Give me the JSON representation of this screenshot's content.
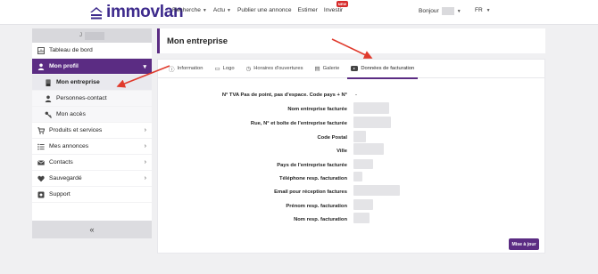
{
  "header": {
    "logo_text": "immovlan",
    "nav": [
      {
        "label": "Recherche",
        "caret": true
      },
      {
        "label": "Actu",
        "caret": true
      },
      {
        "label": "Publier une annonce",
        "caret": false
      },
      {
        "label": "Estimer",
        "caret": false
      },
      {
        "label": "Investir",
        "caret": false,
        "badge": "NEW"
      }
    ],
    "greeting": "Bonjour",
    "language": "FR"
  },
  "sidebar": {
    "user_initial": "J",
    "items": [
      {
        "label": "Tableau de bord",
        "icon": "dashboard-icon"
      },
      {
        "label": "Mon profil",
        "icon": "user-icon"
      },
      {
        "label": "Mon entreprise",
        "icon": "building-icon"
      },
      {
        "label": "Personnes-contact",
        "icon": "person-icon"
      },
      {
        "label": "Mon accès",
        "icon": "key-icon"
      },
      {
        "label": "Produits et services",
        "icon": "cart-icon"
      },
      {
        "label": "Mes annonces",
        "icon": "list-icon"
      },
      {
        "label": "Contacts",
        "icon": "envelope-icon"
      },
      {
        "label": "Sauvegardé",
        "icon": "heart-icon"
      },
      {
        "label": "Support",
        "icon": "support-icon"
      }
    ],
    "collapse_glyph": "«"
  },
  "main": {
    "title": "Mon entreprise",
    "tabs": [
      {
        "label": "Information",
        "icon": "info-icon"
      },
      {
        "label": "Logo",
        "icon": "image-icon"
      },
      {
        "label": "Horaires d'ouvertures",
        "icon": "clock-icon"
      },
      {
        "label": "Galerie",
        "icon": "gallery-icon"
      },
      {
        "label": "Données de facturation",
        "icon": "youtube-icon"
      }
    ],
    "fields": [
      {
        "label": "N° TVA Pas de point, pas d'espace. Code pays + N°",
        "value": "-"
      },
      {
        "label": "Nom entreprise facturée",
        "value": ""
      },
      {
        "label": "Rue, N° et boîte de l'entreprise facturée",
        "value": ""
      },
      {
        "label": "Code Postal",
        "value": ""
      },
      {
        "label": "Ville",
        "value": ""
      },
      {
        "label": "Pays de l'entreprise facturée",
        "value": ""
      },
      {
        "label": "Téléphone resp. facturation",
        "value": ""
      },
      {
        "label": "Email pour réception factures",
        "value": ""
      },
      {
        "label": "Prénom resp. facturation",
        "value": ""
      },
      {
        "label": "Nom resp. facturation",
        "value": ""
      }
    ],
    "save_label": "Mise à jour"
  },
  "colors": {
    "brand_purple": "#5b2c83",
    "annotation_red": "#e03a2c"
  }
}
